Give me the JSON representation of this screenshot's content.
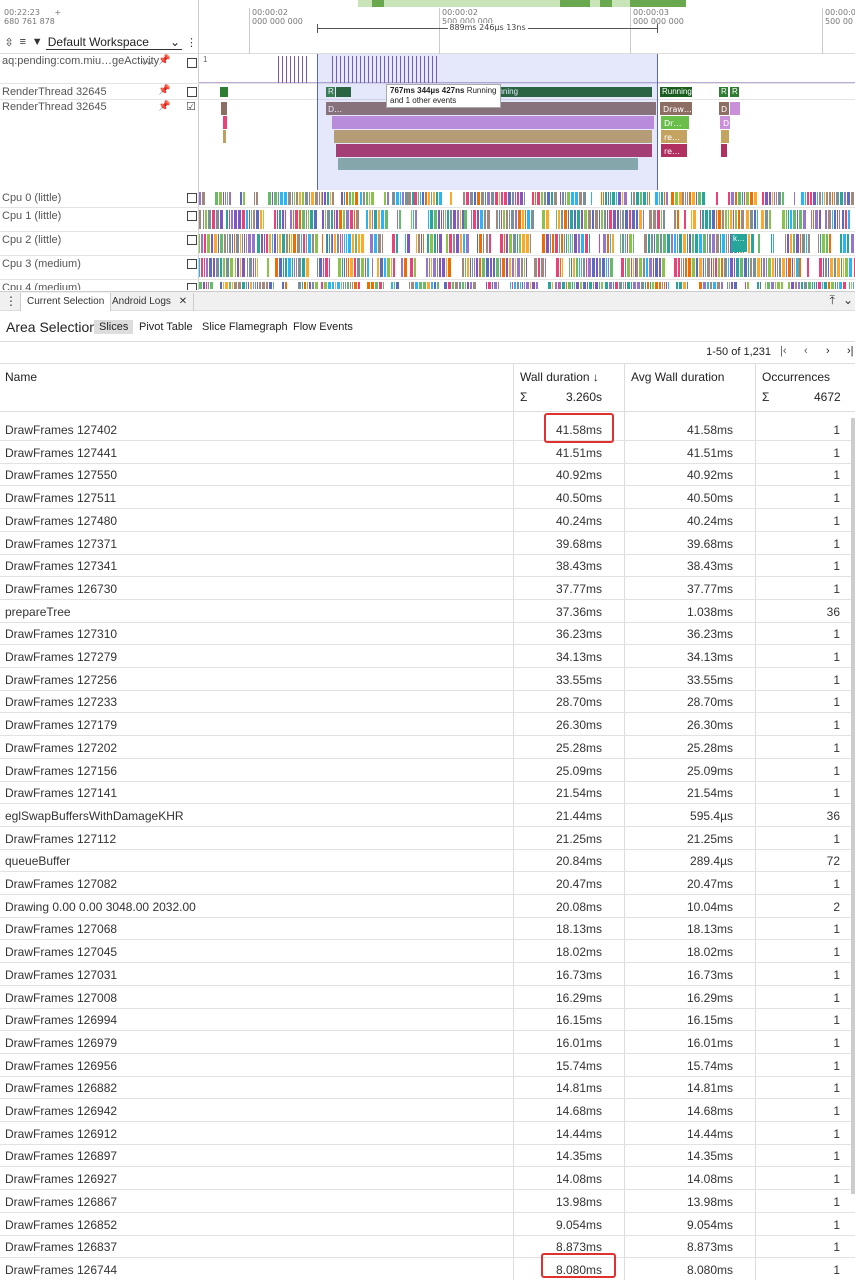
{
  "timeline": {
    "origin_time": "00:22:23",
    "origin_sub": "680 761 878",
    "ticks": [
      {
        "top": "00:00:02",
        "bottom": "000 000 000"
      },
      {
        "top": "00:00:02",
        "bottom": "500 000 000"
      },
      {
        "top": "00:00:03",
        "bottom": "000 000 000"
      },
      {
        "top": "00:00:0",
        "bottom": "500 00"
      }
    ],
    "duration_label": "889ms 246µs 13ns",
    "workspace": "Default Workspace",
    "tracks": [
      {
        "label": "aq:pending:com.miu…geActivity",
        "value": "1"
      },
      {
        "label": "RenderThread 32645"
      },
      {
        "label": "RenderThread 32645"
      }
    ],
    "tooltip": {
      "line1_bold": "767ms 344µs 427ns",
      "line1_rest": "Running",
      "line2": "and 1 other events"
    },
    "slice_labels": {
      "running": "Running",
      "r": "R",
      "unning": "unning",
      "draw": "Draw…",
      "dr": "Dr…",
      "re": "re…",
      "d": "D",
      "dd": "D…",
      "k": "k…"
    },
    "cpus": [
      "Cpu 0 (little)",
      "Cpu 1 (little)",
      "Cpu 2 (little)",
      "Cpu 3 (medium)",
      "Cpu 4 (medium)"
    ]
  },
  "panel": {
    "tabs": [
      {
        "label": "Current Selection"
      },
      {
        "label": "Android Logs"
      }
    ]
  },
  "area": {
    "title": "Area Selection",
    "subtabs": [
      "Slices",
      "Pivot Table",
      "Slice Flamegraph",
      "Flow Events"
    ]
  },
  "pager": {
    "text": "1-50 of 1,231"
  },
  "table": {
    "columns": {
      "name": "Name",
      "wall": "Wall duration ↓",
      "avg": "Avg Wall duration",
      "occ": "Occurrences"
    },
    "sum_symbol": "Σ",
    "sum_wall": "3.260s",
    "sum_occ": "4672",
    "rows": [
      [
        "DrawFrames 127402",
        "41.58ms",
        "41.58ms",
        "1"
      ],
      [
        "DrawFrames 127441",
        "41.51ms",
        "41.51ms",
        "1"
      ],
      [
        "DrawFrames 127550",
        "40.92ms",
        "40.92ms",
        "1"
      ],
      [
        "DrawFrames 127511",
        "40.50ms",
        "40.50ms",
        "1"
      ],
      [
        "DrawFrames 127480",
        "40.24ms",
        "40.24ms",
        "1"
      ],
      [
        "DrawFrames 127371",
        "39.68ms",
        "39.68ms",
        "1"
      ],
      [
        "DrawFrames 127341",
        "38.43ms",
        "38.43ms",
        "1"
      ],
      [
        "DrawFrames 126730",
        "37.77ms",
        "37.77ms",
        "1"
      ],
      [
        "prepareTree",
        "37.36ms",
        "1.038ms",
        "36"
      ],
      [
        "DrawFrames 127310",
        "36.23ms",
        "36.23ms",
        "1"
      ],
      [
        "DrawFrames 127279",
        "34.13ms",
        "34.13ms",
        "1"
      ],
      [
        "DrawFrames 127256",
        "33.55ms",
        "33.55ms",
        "1"
      ],
      [
        "DrawFrames 127233",
        "28.70ms",
        "28.70ms",
        "1"
      ],
      [
        "DrawFrames 127179",
        "26.30ms",
        "26.30ms",
        "1"
      ],
      [
        "DrawFrames 127202",
        "25.28ms",
        "25.28ms",
        "1"
      ],
      [
        "DrawFrames 127156",
        "25.09ms",
        "25.09ms",
        "1"
      ],
      [
        "DrawFrames 127141",
        "21.54ms",
        "21.54ms",
        "1"
      ],
      [
        "eglSwapBuffersWithDamageKHR",
        "21.44ms",
        "595.4µs",
        "36"
      ],
      [
        "DrawFrames 127112",
        "21.25ms",
        "21.25ms",
        "1"
      ],
      [
        "queueBuffer",
        "20.84ms",
        "289.4µs",
        "72"
      ],
      [
        "DrawFrames 127082",
        "20.47ms",
        "20.47ms",
        "1"
      ],
      [
        "Drawing 0.00 0.00 3048.00 2032.00",
        "20.08ms",
        "10.04ms",
        "2"
      ],
      [
        "DrawFrames 127068",
        "18.13ms",
        "18.13ms",
        "1"
      ],
      [
        "DrawFrames 127045",
        "18.02ms",
        "18.02ms",
        "1"
      ],
      [
        "DrawFrames 127031",
        "16.73ms",
        "16.73ms",
        "1"
      ],
      [
        "DrawFrames 127008",
        "16.29ms",
        "16.29ms",
        "1"
      ],
      [
        "DrawFrames 126994",
        "16.15ms",
        "16.15ms",
        "1"
      ],
      [
        "DrawFrames 126979",
        "16.01ms",
        "16.01ms",
        "1"
      ],
      [
        "DrawFrames 126956",
        "15.74ms",
        "15.74ms",
        "1"
      ],
      [
        "DrawFrames 126882",
        "14.81ms",
        "14.81ms",
        "1"
      ],
      [
        "DrawFrames 126942",
        "14.68ms",
        "14.68ms",
        "1"
      ],
      [
        "DrawFrames 126912",
        "14.44ms",
        "14.44ms",
        "1"
      ],
      [
        "DrawFrames 126897",
        "14.35ms",
        "14.35ms",
        "1"
      ],
      [
        "DrawFrames 126927",
        "14.08ms",
        "14.08ms",
        "1"
      ],
      [
        "DrawFrames 126867",
        "13.98ms",
        "13.98ms",
        "1"
      ],
      [
        "DrawFrames 126852",
        "9.054ms",
        "9.054ms",
        "1"
      ],
      [
        "DrawFrames 126837",
        "8.873ms",
        "8.873ms",
        "1"
      ],
      [
        "DrawFrames 126744",
        "8.080ms",
        "8.080ms",
        "1"
      ]
    ]
  }
}
